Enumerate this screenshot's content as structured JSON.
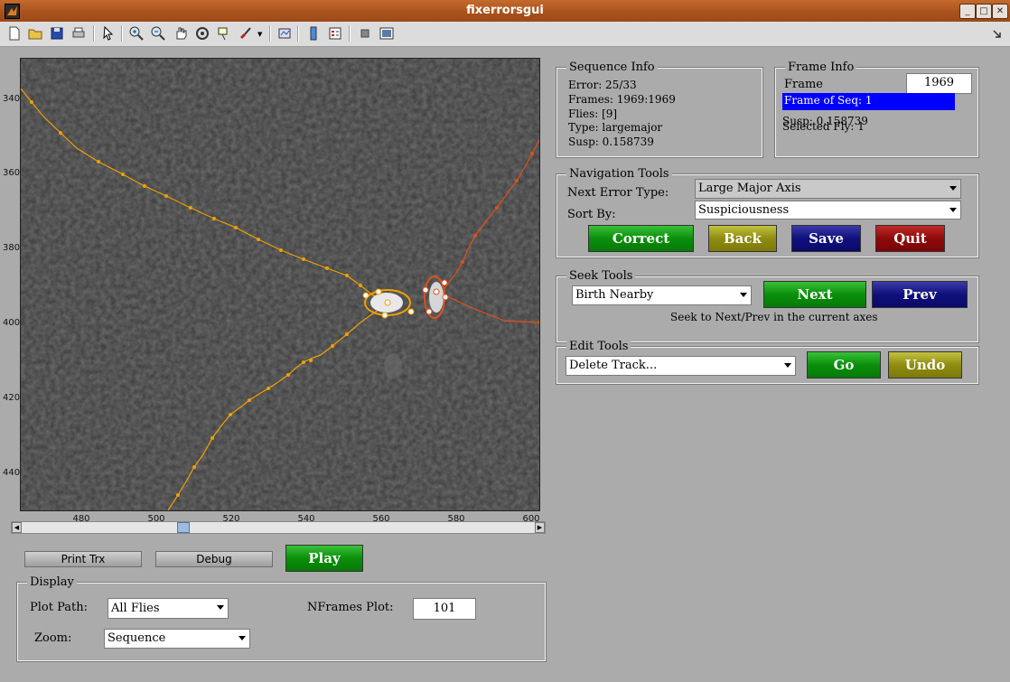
{
  "window": {
    "title": "fixerrorsgui"
  },
  "toolbar": {
    "icons": [
      "new-file-icon",
      "open-folder-icon",
      "save-icon",
      "print-icon",
      "pointer-icon",
      "zoom-in-icon",
      "zoom-out-icon",
      "pan-hand-icon",
      "rotate-3d-icon",
      "data-cursor-icon",
      "brush-icon",
      "link-plot-icon",
      "colorbar-icon",
      "legend-icon",
      "hide-plot-tools-icon",
      "show-plot-tools-icon",
      "dock-arrow-icon"
    ]
  },
  "axes": {
    "y_ticks": [
      "340",
      "360",
      "380",
      "400",
      "420",
      "440"
    ],
    "x_ticks": [
      "480",
      "500",
      "520",
      "540",
      "560",
      "580",
      "600"
    ]
  },
  "buttons": {
    "print_trx": "Print Trx",
    "debug": "Debug",
    "play": "Play",
    "correct": "Correct",
    "back": "Back",
    "save": "Save",
    "quit": "Quit",
    "next": "Next",
    "prev": "Prev",
    "go": "Go",
    "undo": "Undo"
  },
  "display": {
    "title": "Display",
    "plot_path_label": "Plot Path:",
    "plot_path_value": "All Flies",
    "zoom_label": "Zoom:",
    "zoom_value": "Sequence",
    "nframes_label": "NFrames Plot:",
    "nframes_value": "101"
  },
  "sequence_info": {
    "title": "Sequence Info",
    "error": "Error: 25/33",
    "frames": "Frames: 1969:1969",
    "flies": "Flies: [9]",
    "type": "Type: largemajor",
    "susp": "Susp: 0.158739"
  },
  "frame_info": {
    "title": "Frame Info",
    "frame_label": "Frame",
    "frame_value": "1969",
    "frame_of_seq": "Frame of Seq: 1",
    "susp": "Susp: 0.158739",
    "selected_fly": "Selected Fly: 1"
  },
  "navigation": {
    "title": "Navigation Tools",
    "next_error_label": "Next Error Type:",
    "next_error_value": "Large Major Axis",
    "sort_by_label": "Sort By:",
    "sort_by_value": "Suspiciousness"
  },
  "seek": {
    "title": "Seek Tools",
    "mode_value": "Birth Nearby",
    "hint": "Seek to Next/Prev in the current axes"
  },
  "edit": {
    "title": "Edit Tools",
    "action_value": "Delete Track..."
  },
  "colors": {
    "track_orange": "#f0a000",
    "track_red": "#e0501a",
    "titlebar": "#a8511d",
    "selection_blue": "#0000ff"
  }
}
